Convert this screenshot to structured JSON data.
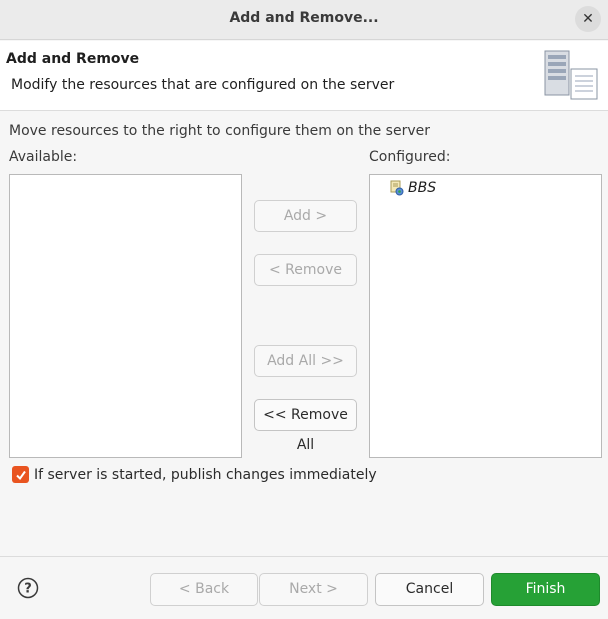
{
  "window": {
    "title": "Add and Remove..."
  },
  "header": {
    "title": "Add and Remove",
    "description": "Modify the resources that are configured on the server"
  },
  "instructions": "Move resources to the right to configure them on the server",
  "available": {
    "label": "Available:",
    "items": []
  },
  "configured": {
    "label": "Configured:",
    "items": [
      {
        "label": "BBS"
      }
    ]
  },
  "buttons": {
    "add": "Add >",
    "remove": "< Remove",
    "add_all": "Add All >>",
    "remove_all": "<< Remove All"
  },
  "publish": {
    "label": "If server is started, publish changes immediately",
    "checked": true
  },
  "footer": {
    "back": "< Back",
    "next": "Next >",
    "cancel": "Cancel",
    "finish": "Finish"
  },
  "colors": {
    "accent": "#e95420",
    "finish": "#26a136"
  }
}
